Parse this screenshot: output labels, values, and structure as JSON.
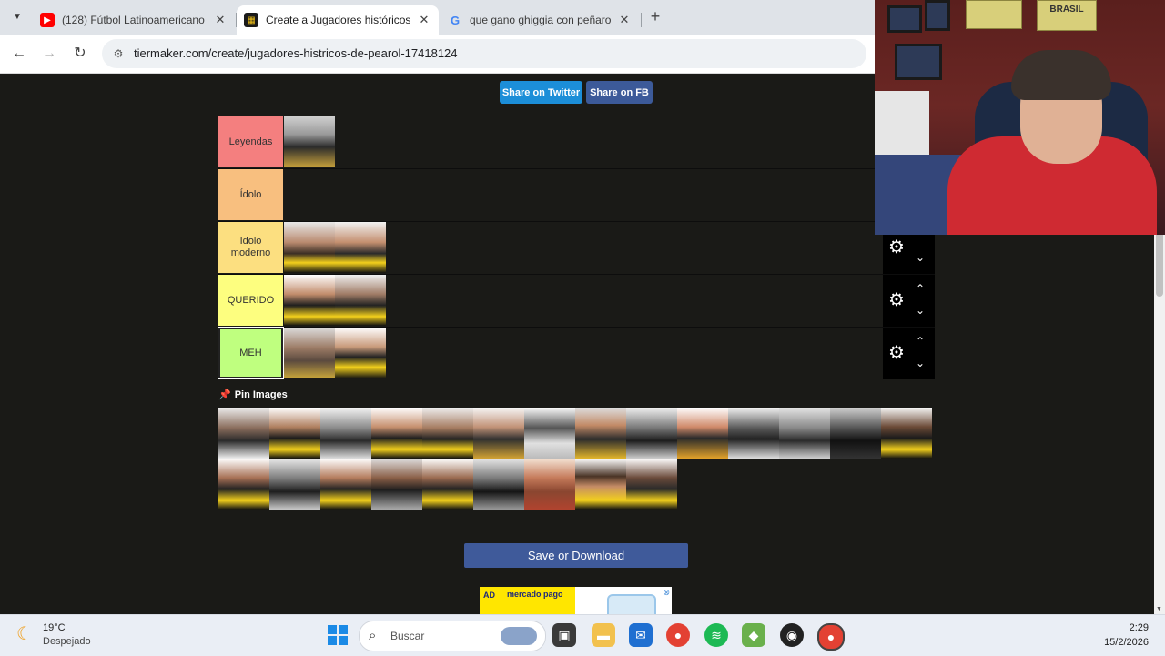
{
  "browser": {
    "tabs": [
      {
        "title": "(128) Fútbol Latinoamericano C",
        "favicon": "youtube-icon",
        "active": false
      },
      {
        "title": "Create a Jugadores históricos d",
        "favicon": "tiermaker-icon",
        "active": true
      },
      {
        "title": "que gano ghiggia con peñarol",
        "favicon": "google-icon",
        "active": false
      }
    ],
    "new_tab": "+",
    "url": "tiermaker.com/create/jugadores-histricos-de-pearol-17418124"
  },
  "page": {
    "share_twitter": "Share on Twitter",
    "share_fb": "Share on FB",
    "tiers": [
      {
        "label": "Leyendas",
        "color": "#f47f7f",
        "count": 1
      },
      {
        "label": "Ídolo",
        "color": "#f8bf7f",
        "count": 0
      },
      {
        "label": "Idolo moderno",
        "color": "#fcdf80",
        "count": 2
      },
      {
        "label": "QUERIDO",
        "color": "#fdfe7f",
        "count": 2
      },
      {
        "label": "MEH",
        "color": "#bfff7f",
        "count": 2,
        "selected": true
      }
    ],
    "pin_images": "Pin Images",
    "pool_count": 23,
    "save_button": "Save or Download",
    "ad": {
      "tag": "AD",
      "brand": "mercado pago"
    }
  },
  "taskbar": {
    "temperature": "19°C",
    "weather": "Despejado",
    "search_placeholder": "Buscar",
    "time": "2:29",
    "date": "15/2/2026"
  },
  "webcam": {
    "poster_text": "BRASIL"
  }
}
